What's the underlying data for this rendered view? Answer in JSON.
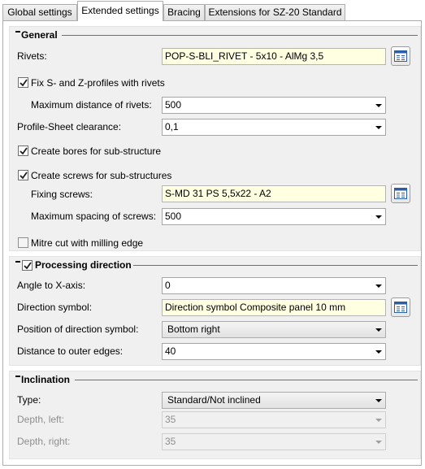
{
  "tabs": [
    {
      "label": "Global settings"
    },
    {
      "label": "Extended settings"
    },
    {
      "label": "Bracing"
    },
    {
      "label": "Extensions for SZ-20 Standard"
    }
  ],
  "general": {
    "title": "General",
    "rivets_label": "Rivets:",
    "rivets_value": "POP-S-BLI_RIVET -  5x10 - AlMg 3,5",
    "fix_profiles_label": "Fix S- and Z-profiles with rivets",
    "fix_profiles_checked": true,
    "max_distance_label": "Maximum distance of rivets:",
    "max_distance_value": "500",
    "clearance_label": "Profile-Sheet clearance:",
    "clearance_value": "0,1",
    "create_bores_label": "Create bores for sub-structure",
    "create_bores_checked": true,
    "create_screws_label": "Create screws for sub-structures",
    "create_screws_checked": true,
    "fixing_screws_label": "Fixing screws:",
    "fixing_screws_value": "S-MD 31 PS 5,5x22 - A2",
    "max_spacing_label": "Maximum spacing of screws:",
    "max_spacing_value": "500",
    "mitre_label": "Mitre cut with milling edge",
    "mitre_checked": false
  },
  "processing": {
    "title": "Processing direction",
    "enabled": true,
    "angle_label": "Angle to X-axis:",
    "angle_value": "0",
    "symbol_label": "Direction symbol:",
    "symbol_value": "Direction symbol Composite panel 10 mm",
    "position_label": "Position of direction symbol:",
    "position_value": "Bottom right",
    "distance_label": "Distance to outer edges:",
    "distance_value": "40"
  },
  "inclination": {
    "title": "Inclination",
    "type_label": "Type:",
    "type_value": "Standard/Not inclined",
    "depth_left_label": "Depth, left:",
    "depth_left_value": "35",
    "depth_right_label": "Depth, right:",
    "depth_right_value": "35"
  },
  "colors": {
    "accent_yellow": "#ffffe1",
    "group_bg": "#f0f0f0",
    "disabled_text": "#8e8e8e"
  },
  "icons": {
    "browse": "catalog-browse-icon",
    "check": "checkmark-icon",
    "collapse": "collapse-minus-icon",
    "dropdown": "chevron-down-icon"
  }
}
